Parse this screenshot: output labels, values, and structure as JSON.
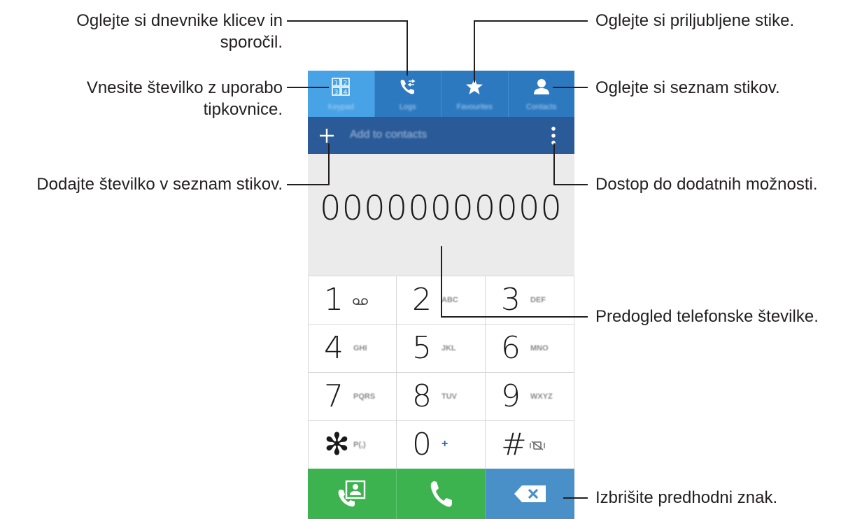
{
  "callouts": {
    "logs": [
      "Oglejte si dnevnike klicev in",
      "sporočil."
    ],
    "keypad": [
      "Vnesite številko z uporabo",
      "tipkovnice."
    ],
    "add_contact": "Dodajte številko v seznam stikov.",
    "favourites": "Oglejte si priljubljene stike.",
    "contacts": "Oglejte si seznam stikov.",
    "more_options": "Dostop do dodatnih možnosti.",
    "preview": "Predogled telefonske številke.",
    "delete": "Izbrišite predhodni znak."
  },
  "tabs": [
    {
      "label": "Keypad",
      "icon": "keypad-icon",
      "active": true
    },
    {
      "label": "Logs",
      "icon": "logs-icon",
      "active": false
    },
    {
      "label": "Favourites",
      "icon": "star-icon",
      "active": false
    },
    {
      "label": "Contacts",
      "icon": "person-icon",
      "active": false
    }
  ],
  "actionbar": {
    "add_label": "Add to contacts"
  },
  "display": {
    "number": "00000000000"
  },
  "keys": [
    {
      "digit": "1",
      "sub": "",
      "icon": "voicemail-icon"
    },
    {
      "digit": "2",
      "sub": "ABC"
    },
    {
      "digit": "3",
      "sub": "DEF"
    },
    {
      "digit": "4",
      "sub": "GHI"
    },
    {
      "digit": "5",
      "sub": "JKL"
    },
    {
      "digit": "6",
      "sub": "MNO"
    },
    {
      "digit": "7",
      "sub": "PQRS"
    },
    {
      "digit": "8",
      "sub": "TUV"
    },
    {
      "digit": "9",
      "sub": "WXYZ"
    },
    {
      "digit": "✻",
      "sub": "P(,)"
    },
    {
      "digit": "0",
      "sub": "+"
    },
    {
      "digit": "#",
      "sub": "",
      "icon": "mute-icon"
    }
  ],
  "colors": {
    "tab_bar": "#2d79c0",
    "tab_active": "#48a3e6",
    "action_bar": "#2a5a97",
    "display_bg": "#ebebeb",
    "call_green": "#3db350",
    "delete_blue": "#4a90c8"
  }
}
